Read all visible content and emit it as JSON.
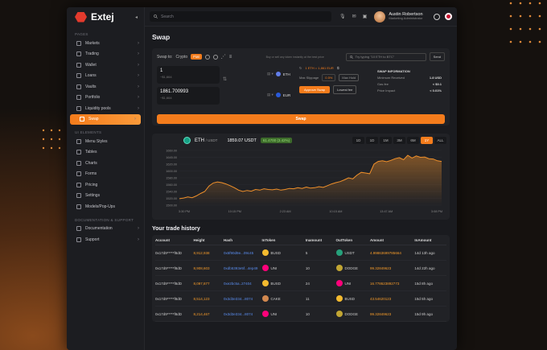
{
  "app": {
    "name": "Extej"
  },
  "colors": {
    "accent": "#f47c1c",
    "chart_line": "#f0902a",
    "positive": "#9be37a"
  },
  "sidebar": {
    "pages_label": "PAGES",
    "items": [
      {
        "label": "Markets",
        "icon": "markets-icon",
        "active": false
      },
      {
        "label": "Trading",
        "icon": "trading-icon",
        "active": false
      },
      {
        "label": "Wallet",
        "icon": "wallet-icon",
        "active": false
      },
      {
        "label": "Loans",
        "icon": "loans-icon",
        "active": false
      },
      {
        "label": "Vaults",
        "icon": "vault-icon",
        "active": false
      },
      {
        "label": "Portfolio",
        "icon": "portfolio-icon",
        "active": false
      },
      {
        "label": "Liquidity pools",
        "icon": "pool-icon",
        "active": false
      },
      {
        "label": "Swap",
        "icon": "swap-icon",
        "active": true
      }
    ],
    "ui_label": "UI ELEMENTS",
    "ui_items": [
      {
        "label": "Menu Styles"
      },
      {
        "label": "Tables"
      },
      {
        "label": "Charts"
      },
      {
        "label": "Forms"
      },
      {
        "label": "Pricing"
      },
      {
        "label": "Settings"
      },
      {
        "label": "Models/Pop-Ups"
      }
    ],
    "doc_label": "DOCUMENTATION & SUPPORT",
    "doc_items": [
      {
        "label": "Documentation"
      },
      {
        "label": "Support"
      }
    ]
  },
  "topbar": {
    "search_placeholder": "Search",
    "user_name": "Austin Robertson",
    "user_role": "Marketing Administrator"
  },
  "page": {
    "title": "Swap"
  },
  "swap": {
    "swap_to_label": "Swap to:",
    "mode_crypto": "Crypto",
    "mode_fiat": "Fiat",
    "note": "Buy or sell any token instantly at the best price",
    "try_placeholder": "Try typing \"10 ETH to BTC\"",
    "send_label": "Send",
    "from_amount": "1",
    "from_sub": "~$1,664",
    "from_token": "ETH",
    "to_amount": "1861.700993",
    "to_sub": "~$1,664",
    "to_token": "EUR",
    "rate": "1 ETH = 1,861 EUR",
    "max_slippage_label": "Max Slippage",
    "max_slippage_value": "0.5%",
    "max_hold_label": "Max Hold",
    "add_btn": "Approve Swap",
    "lowest_label": "Lowest fee",
    "info_title": "SWAP INFORMATION",
    "info_rows": [
      {
        "label": "Minimum Received",
        "value": "1.8 USD"
      },
      {
        "label": "Gas fee",
        "value": "< $0.1"
      },
      {
        "label": "Price Impact",
        "value": "< 0.01%"
      }
    ],
    "swap_button": "Swap"
  },
  "chart_header": {
    "pair": "ETH",
    "quote": "/ USDT",
    "price": "1859.07 USDT",
    "change": "61.4700 (3.42%)",
    "timeframes": [
      "1D",
      "1D",
      "1M",
      "3M",
      "6M",
      "1Y",
      "ALL"
    ],
    "active_timeframe": "1Y"
  },
  "chart_data": {
    "type": "area",
    "title": "",
    "xlabel": "",
    "ylabel": "",
    "y_ticks": [
      "1660.00",
      "1645.00",
      "1620.00",
      "1600.00",
      "1580.00",
      "1560.00",
      "1540.00",
      "1520.00",
      "1500.00"
    ],
    "x_ticks": [
      "3:30 PM",
      "10:15 PM",
      "2:23 AM",
      "10:15 AM",
      "13:47 AM",
      "3:08 PM"
    ],
    "ylim": [
      1500,
      1660
    ],
    "series": [
      {
        "values": [
          1519,
          1521,
          1524,
          1522,
          1527,
          1534,
          1540,
          1556,
          1565,
          1568,
          1566,
          1562,
          1557,
          1551,
          1544,
          1540,
          1543,
          1541,
          1546,
          1544,
          1548,
          1546,
          1545,
          1547,
          1544,
          1546,
          1549,
          1548,
          1551,
          1549,
          1553,
          1550,
          1551,
          1554,
          1552,
          1557,
          1562,
          1566,
          1569,
          1574,
          1580,
          1577,
          1588,
          1596,
          1594,
          1592,
          1620,
          1628,
          1630,
          1627,
          1631,
          1636,
          1639,
          1633,
          1646,
          1638,
          1644,
          1640,
          1641,
          1636,
          1635,
          1630,
          1628
        ]
      }
    ]
  },
  "history": {
    "title": "Your trade history",
    "columns": [
      "Account",
      "Height",
      "Hash",
      "InToken",
      "Inamount",
      "OutToken",
      "Amount",
      "InAmount"
    ],
    "rows": [
      {
        "account": "0x17d9*****f8dD",
        "height": "8,912,938",
        "hash": "0x5f90d9e...09c45",
        "in_token": "BUSD",
        "in_color": "#f3ba2f",
        "inamount": "5",
        "out_token": "USDT",
        "out_color": "#26a17b",
        "amount": "4.99863699785664",
        "time": "14d 13h ago"
      },
      {
        "account": "0x17d9*****f8dD",
        "height": "8,908,603",
        "hash": "0xdb5393e5f...4ep49",
        "in_token": "UNI",
        "in_color": "#ff007a",
        "inamount": "10",
        "out_token": "DODGE",
        "out_color": "#c2a633",
        "amount": "99.32849623",
        "time": "14d 22h ago"
      },
      {
        "account": "0x17d9*****f8dD",
        "height": "8,097,877",
        "hash": "0xe2bc5a..27404",
        "in_token": "BUSD",
        "in_color": "#f3ba2f",
        "inamount": "24",
        "out_token": "UNI",
        "out_color": "#ff007a",
        "amount": "16.778623892773",
        "time": "15d 8h ago"
      },
      {
        "account": "0x17d9*****f8dD",
        "height": "8,514,123",
        "hash": "0x3d3e334...8074",
        "in_token": "CAKE",
        "in_color": "#d1884f",
        "inamount": "11",
        "out_token": "BUSD",
        "out_color": "#f3ba2f",
        "amount": "43.54620123",
        "time": "15d 5h ago"
      },
      {
        "account": "0x17d9*****f8dD",
        "height": "8,214,467",
        "hash": "0x3d3e334...8074",
        "in_token": "UNI",
        "in_color": "#ff007a",
        "inamount": "10",
        "out_token": "DODGE",
        "out_color": "#c2a633",
        "amount": "99.32849623",
        "time": "15d 9h ago"
      }
    ]
  }
}
